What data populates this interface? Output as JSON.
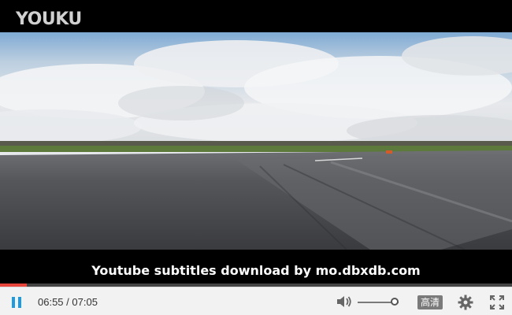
{
  "player": {
    "logo_text": "YOUKU",
    "subtitle": "Youtube subtitles download by mo.dbxdb.com",
    "progress_fraction": 0.052,
    "controls": {
      "current_time": "06:55",
      "separator": "/",
      "total_time": "07:05",
      "quality_label": "高清",
      "volume_level": 0.9
    }
  },
  "colors": {
    "progress": "#e8453c",
    "play_icon": "#1e9be0",
    "controls_bg": "#f2f2f2"
  },
  "icons": {
    "play_pause": "pause-icon",
    "volume": "volume-icon",
    "settings": "gear-icon",
    "fullscreen": "fullscreen-icon"
  }
}
